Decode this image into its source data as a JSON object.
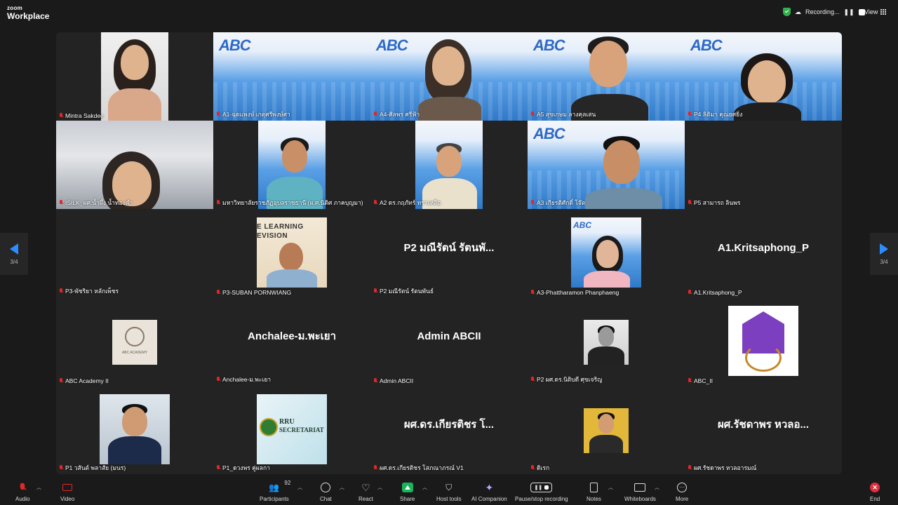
{
  "app": {
    "brand_top": "zoom",
    "brand_bottom": "Workplace"
  },
  "topbar": {
    "recording_label": "Recording...",
    "view_label": "View"
  },
  "nav": {
    "page_left": "3/4",
    "page_right": "3/4"
  },
  "tiles": [
    {
      "label": "Mintra Sakdee"
    },
    {
      "label": "A1-ฉุดแพงษ์ เกตุศรีพงษ์ศา"
    },
    {
      "label": "A4-ศิลพร ศรีฟ้า"
    },
    {
      "label": "A5 สุขเกษม ลางคุลเสน"
    },
    {
      "label": "P4 ลิติมา คุณยศยิ่ง"
    },
    {
      "label": "ISILK_ผศ.น้ำผึ้ง น้ำทองคำ"
    },
    {
      "label": "มหาวิทยาลัยราชภัฏอุบลราชธานี (ผ.ศ.นิติศ ภาคบุญมา)"
    },
    {
      "label": "A2 ดร.กฤภัทร์ ทราเหลือ"
    },
    {
      "label": "A3 เกียรติศักดิ์ โจ๊ต"
    },
    {
      "label": "P5 สามารถ ลินพร"
    },
    {
      "label": "P3-พัชริยา หลักเพ็ชร"
    },
    {
      "label": "P3-SUBAN PORNWIANG",
      "sign_line1": "E LEARNING",
      "sign_line2": "EVISION"
    },
    {
      "label": "P2 มณีรัตน์ รัตนพันธ์",
      "display_name": "P2 มณีรัตน์ รัตนพั..."
    },
    {
      "label": "A3-Phattharamon Phanphaeng",
      "abc": "ABC"
    },
    {
      "label": "A1.Kritsaphong_P",
      "display_name": "A1.Kritsaphong_P"
    },
    {
      "label": "ABC Academy II",
      "logo_text": "ABC ACADEMY"
    },
    {
      "label": "Anchalee-ม.พะเยา",
      "display_name": "Anchalee-ม.พะเยา"
    },
    {
      "label": "Admin ABCII",
      "display_name": "Admin ABCII"
    },
    {
      "label": "P2 ผศ.ดร.นิติบดี ศุขเจริญ"
    },
    {
      "label": "ABC_II"
    },
    {
      "label": "P1 วสันต์ พลาสัย (มนร)"
    },
    {
      "label": "P1_ดวงพร คู่ผลกา",
      "logo_text1": "RRU",
      "logo_text2": "SECRETARIAT"
    },
    {
      "label": "ผศ.ดร.เกียรติชร โสภณาภรณ์ V1",
      "display_name": "ผศ.ดร.เกียรติชร โ..."
    },
    {
      "label": "ดิเรก"
    },
    {
      "label": "ผศ.รัชดาพร หวลอารมณ์",
      "display_name": "ผศ.รัชดาพร หวลอ..."
    }
  ],
  "abc_banner": "ABC",
  "toolbar": {
    "audio": "Audio",
    "video": "Video",
    "participants": "Participants",
    "participants_count": "92",
    "chat": "Chat",
    "react": "React",
    "share": "Share",
    "host_tools": "Host tools",
    "ai_companion": "AI Companion",
    "pause_stop": "Pause/stop recording",
    "notes": "Notes",
    "whiteboards": "Whiteboards",
    "more": "More",
    "end": "End"
  },
  "colors": {
    "accent": "#2d8cff",
    "muted_mic": "#e02828",
    "share_green": "#1bb35a",
    "end_red": "#e02d3c"
  }
}
